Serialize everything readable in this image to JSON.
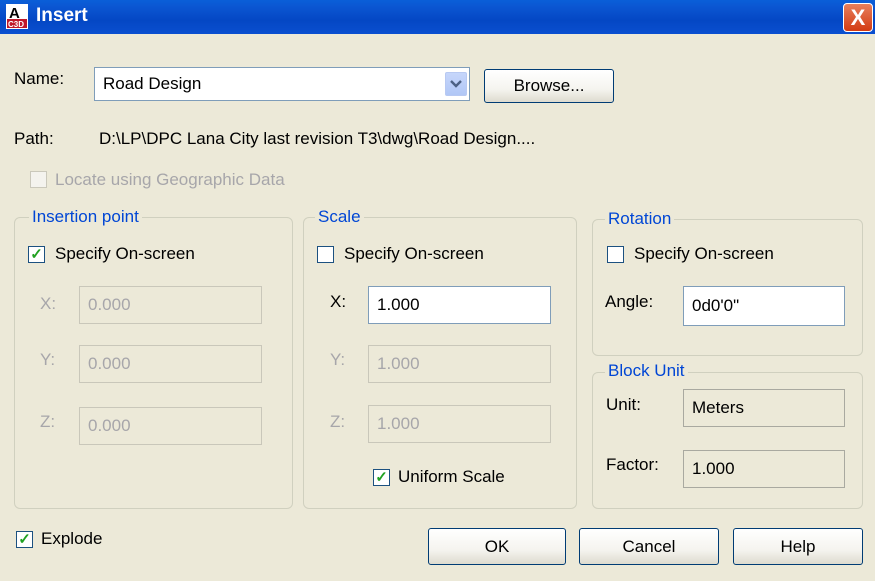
{
  "window": {
    "title": "Insert",
    "close_label": "X"
  },
  "name_row": {
    "label": "Name:",
    "value": "Road Design",
    "browse_label": "Browse..."
  },
  "path_row": {
    "label": "Path:",
    "value": "D:\\LP\\DPC Lana City last revision T3\\dwg\\Road Design...."
  },
  "geo": {
    "label": "Locate using Geographic Data",
    "checked": false
  },
  "insertion": {
    "title": "Insertion point",
    "specify_label": "Specify On-screen",
    "x_label": "X:",
    "x_value": "0.000",
    "y_label": "Y:",
    "y_value": "0.000",
    "z_label": "Z:",
    "z_value": "0.000"
  },
  "scale": {
    "title": "Scale",
    "specify_label": "Specify On-screen",
    "x_label": "X:",
    "x_value": "1.000",
    "y_label": "Y:",
    "y_value": "1.000",
    "z_label": "Z:",
    "z_value": "1.000",
    "uniform_label": "Uniform Scale"
  },
  "rotation": {
    "title": "Rotation",
    "specify_label": "Specify On-screen",
    "angle_label": "Angle:",
    "angle_value": "0d0'0\""
  },
  "block_unit": {
    "title": "Block Unit",
    "unit_label": "Unit:",
    "unit_value": "Meters",
    "factor_label": "Factor:",
    "factor_value": "1.000"
  },
  "explode": {
    "label": "Explode"
  },
  "buttons": {
    "ok": "OK",
    "cancel": "Cancel",
    "help": "Help"
  },
  "checkmark": "✓",
  "icons": {
    "app": "autocad-c3d-icon",
    "combo": "chevron-down-icon"
  },
  "colors": {
    "titlebar": "#0447c4",
    "group_title": "#0046d5",
    "dialog_bg": "#ece9d8",
    "check": "#21a121"
  }
}
